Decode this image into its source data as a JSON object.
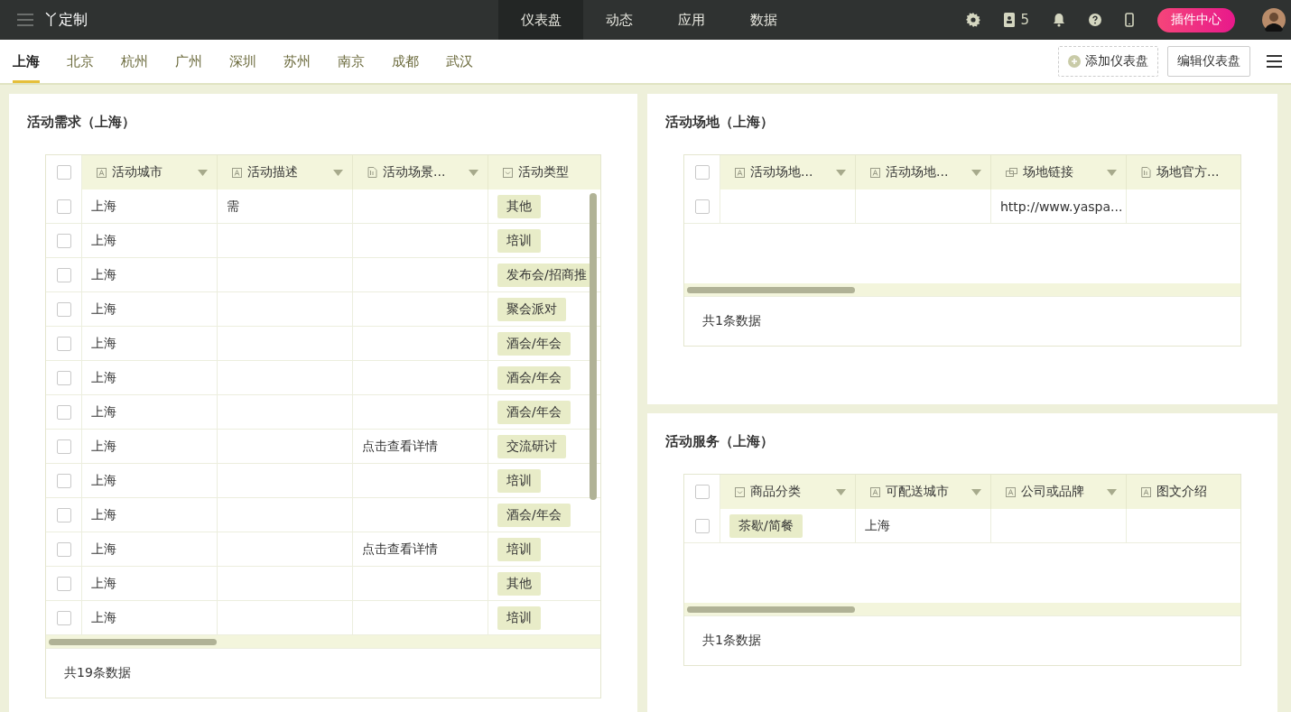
{
  "app": {
    "title": "丫定制"
  },
  "nav": [
    {
      "label": "仪表盘",
      "selected": true
    },
    {
      "label": "动态",
      "selected": false
    },
    {
      "label": "应用",
      "selected": false
    },
    {
      "label": "数据",
      "selected": false
    }
  ],
  "toolbar": {
    "contacts_count": "5",
    "plugin_button": "插件中心"
  },
  "city_tabs": [
    {
      "label": "上海",
      "selected": true
    },
    {
      "label": "北京",
      "selected": false
    },
    {
      "label": "杭州",
      "selected": false
    },
    {
      "label": "广州",
      "selected": false
    },
    {
      "label": "深圳",
      "selected": false
    },
    {
      "label": "苏州",
      "selected": false
    },
    {
      "label": "南京",
      "selected": false
    },
    {
      "label": "成都",
      "selected": false
    },
    {
      "label": "武汉",
      "selected": false
    }
  ],
  "actions": {
    "add": "添加仪表盘",
    "edit": "编辑仪表盘"
  },
  "panels": [
    {
      "title": "活动需求（上海）",
      "footer": "共19条数据",
      "all_checked": false,
      "columns": [
        {
          "label": "活动城市",
          "kind": "text"
        },
        {
          "label": "活动描述",
          "kind": "text"
        },
        {
          "label": "活动场景...",
          "kind": "file"
        },
        {
          "label": "活动类型",
          "kind": "select"
        }
      ],
      "rows": [
        {
          "checked": false,
          "cells": [
            "上海",
            "需",
            null,
            "其他"
          ]
        },
        {
          "checked": false,
          "cells": [
            "上海",
            null,
            null,
            "培训"
          ]
        },
        {
          "checked": false,
          "cells": [
            "上海",
            null,
            null,
            "发布会/招商推"
          ]
        },
        {
          "checked": false,
          "cells": [
            "上海",
            null,
            null,
            "聚会派对"
          ]
        },
        {
          "checked": false,
          "cells": [
            "上海",
            null,
            null,
            "酒会/年会"
          ]
        },
        {
          "checked": false,
          "cells": [
            "上海",
            null,
            null,
            "酒会/年会"
          ]
        },
        {
          "checked": false,
          "cells": [
            "上海",
            null,
            null,
            "酒会/年会"
          ]
        },
        {
          "checked": false,
          "cells": [
            "上海",
            null,
            "点击查看详情",
            "交流研讨"
          ]
        },
        {
          "checked": false,
          "cells": [
            "上海",
            null,
            null,
            "培训"
          ]
        },
        {
          "checked": false,
          "cells": [
            "上海",
            null,
            null,
            "酒会/年会"
          ]
        },
        {
          "checked": false,
          "cells": [
            "上海",
            null,
            "点击查看详情",
            "培训"
          ]
        },
        {
          "checked": false,
          "cells": [
            "上海",
            null,
            null,
            "其他"
          ]
        },
        {
          "checked": false,
          "cells": [
            "上海",
            null,
            null,
            "培训"
          ]
        }
      ]
    },
    {
      "title": "活动场地（上海）",
      "footer": "共1条数据",
      "all_checked": false,
      "columns": [
        {
          "label": "活动场地...",
          "kind": "text"
        },
        {
          "label": "活动场地...",
          "kind": "text"
        },
        {
          "label": "场地链接",
          "kind": "link"
        },
        {
          "label": "场地官方...",
          "kind": "file"
        }
      ],
      "rows": [
        {
          "checked": false,
          "cells": [
            null,
            null,
            "http://www.yaspa...",
            null
          ]
        }
      ]
    },
    {
      "title": "活动服务（上海）",
      "footer": "共1条数据",
      "all_checked": false,
      "columns": [
        {
          "label": "商品分类",
          "kind": "select"
        },
        {
          "label": "可配送城市",
          "kind": "text"
        },
        {
          "label": "公司或品牌",
          "kind": "text"
        },
        {
          "label": "图文介绍",
          "kind": "text"
        }
      ],
      "rows": [
        {
          "checked": false,
          "cells": [
            "茶歇/简餐",
            "上海",
            null,
            null
          ]
        }
      ]
    }
  ]
}
